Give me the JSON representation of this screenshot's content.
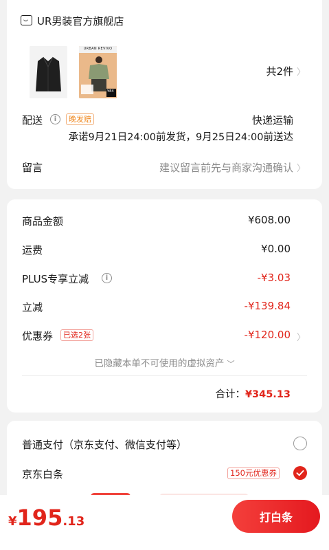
{
  "store": {
    "name": "UR男装官方旗舰店",
    "icon": "store-icon"
  },
  "products": {
    "count_label": "共2件",
    "item2_brand": "URBAN REVIVO",
    "item2_price_tag": "¥84"
  },
  "delivery": {
    "label": "配送",
    "badge": "晚发赔",
    "method": "快递运输",
    "promise": "承诺9月21日24:00前发货，9月25日24:00前送达"
  },
  "message": {
    "label": "留言",
    "placeholder": "建议留言前先与商家沟通确认"
  },
  "price": {
    "goods_label": "商品金额",
    "goods_value": "¥608.00",
    "shipping_label": "运费",
    "shipping_value": "¥0.00",
    "plus_label": "PLUS专享立减",
    "plus_value": "-¥3.03",
    "discount_label": "立减",
    "discount_value": "-¥139.84",
    "coupon_label": "优惠券",
    "coupon_tag": "已选2张",
    "coupon_value": "-¥120.00",
    "hidden_note": "已隐藏本单不可使用的虚拟资产",
    "total_label": "合计：",
    "total_value": "¥345.13"
  },
  "payment": {
    "normal_label": "普通支付（京东支付、微信支付等）",
    "baitiao_label": "京东白条",
    "baitiao_coupon": "150元优惠券"
  },
  "bottom": {
    "currency": "¥",
    "amount_int": "195",
    "amount_dec": ".13",
    "pay_button": "打白条"
  },
  "colors": {
    "accent": "#e1251b",
    "orange": "#f08a23"
  }
}
